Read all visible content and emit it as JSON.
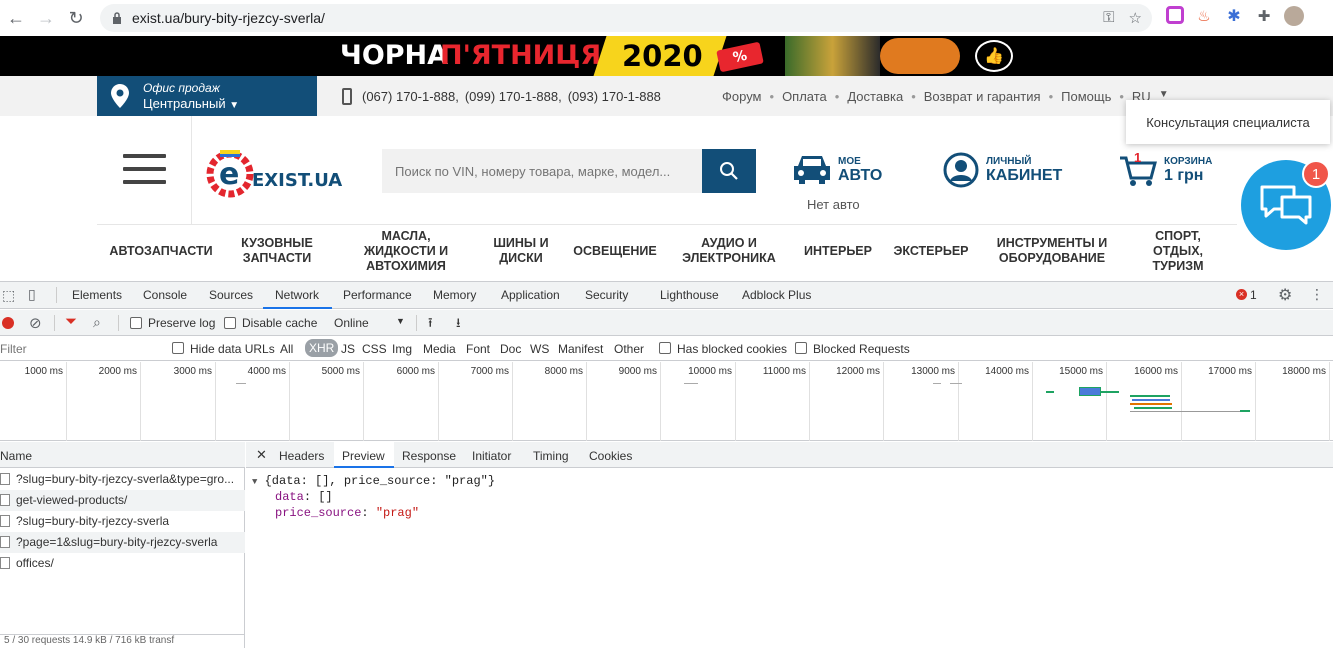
{
  "browser": {
    "url": "exist.ua/bury-bity-rjezcy-sverla/"
  },
  "banner": {
    "text_white": "ЧОРНА",
    "text_red": "П'ЯТНИЦЯ",
    "year": "2020",
    "tag": "%"
  },
  "infobar": {
    "office_title": "Офис продаж",
    "office_value": "Центральный",
    "phones": [
      "(067) 170-1-888,",
      "(099) 170-1-888,",
      "(093) 170-1-888"
    ],
    "links": [
      "Форум",
      "Оплата",
      "Доставка",
      "Возврат и гарантия",
      "Помощь",
      "RU"
    ]
  },
  "header": {
    "logo_text": "EXIST.UA",
    "search_placeholder": "Поиск по VIN, номеру товара, марке, модел...",
    "my_auto_small": "МОЕ",
    "my_auto_big": "АВТО",
    "no_auto": "Нет авто",
    "cabinet_small": "ЛИЧНЫЙ",
    "cabinet_big": "КАБИНЕТ",
    "cart_small": "КОРЗИНА",
    "cart_big": "1 грн",
    "cart_count": "1",
    "tooltip": "Консультация специалиста",
    "chat_badge": "1"
  },
  "categories": [
    "АВТОЗАПЧАСТИ",
    "КУЗОВНЫЕ ЗАПЧАСТИ",
    "МАСЛА, ЖИДКОСТИ И АВТОХИМИЯ",
    "ШИНЫ И ДИСКИ",
    "ОСВЕЩЕНИЕ",
    "АУДИО И ЭЛЕКТРОНИКА",
    "ИНТЕРЬЕР",
    "ЭКСТЕРЬЕР",
    "ИНСТРУМЕНТЫ И ОБОРУДОВАНИЕ",
    "СПОРТ, ОТДЫХ, ТУРИЗМ"
  ],
  "devtools": {
    "tabs": [
      "Elements",
      "Console",
      "Sources",
      "Network",
      "Performance",
      "Memory",
      "Application",
      "Security",
      "Lighthouse",
      "Adblock Plus"
    ],
    "active_tab": "Network",
    "error_count": "1",
    "toolbar": {
      "preserve_log": "Preserve log",
      "disable_cache": "Disable cache",
      "throttle": "Online"
    },
    "filter": {
      "placeholder": "Filter",
      "hide_data_urls": "Hide data URLs",
      "types": [
        "All",
        "XHR",
        "JS",
        "CSS",
        "Img",
        "Media",
        "Font",
        "Doc",
        "WS",
        "Manifest",
        "Other"
      ],
      "active_type": "XHR",
      "has_blocked_cookies": "Has blocked cookies",
      "blocked_requests": "Blocked Requests"
    },
    "timeline_ticks": [
      "1000 ms",
      "2000 ms",
      "3000 ms",
      "4000 ms",
      "5000 ms",
      "6000 ms",
      "7000 ms",
      "8000 ms",
      "9000 ms",
      "10000 ms",
      "11000 ms",
      "12000 ms",
      "13000 ms",
      "14000 ms",
      "15000 ms",
      "16000 ms",
      "17000 ms",
      "18000 ms"
    ],
    "requests_header": "Name",
    "requests": [
      "?slug=bury-bity-rjezcy-sverla&type=gro...",
      "get-viewed-products/",
      "?slug=bury-bity-rjezcy-sverla",
      "?page=1&slug=bury-bity-rjezcy-sverla",
      "offices/"
    ],
    "footer": "5 / 30 requests   14.9 kB / 716 kB transf",
    "preview_tabs": [
      "Headers",
      "Preview",
      "Response",
      "Initiator",
      "Timing",
      "Cookies"
    ],
    "active_preview_tab": "Preview",
    "preview": {
      "summary": "{data: [], price_source: \"prag\"}",
      "data_key": "data",
      "data_val": "[]",
      "ps_key": "price_source",
      "ps_val": "\"prag\""
    }
  }
}
